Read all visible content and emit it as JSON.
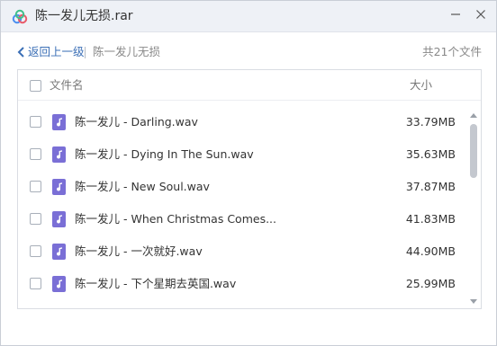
{
  "window": {
    "title": "陈一发儿无损.rar",
    "icon": "cloud-icon",
    "brand_color": "#4a8ef0"
  },
  "nav": {
    "back_label": "返回上一级",
    "breadcrumb": "陈一发儿无损",
    "file_count": "共21个文件",
    "link_color": "#3b6fb6"
  },
  "list": {
    "header_name": "文件名",
    "header_size": "大小",
    "file_icon": "audio-file-icon",
    "file_icon_color": "#7a6fd6",
    "rows": [
      {
        "name": "陈一发儿 - Darling.wav",
        "size": "33.79MB"
      },
      {
        "name": "陈一发儿 - Dying In The Sun.wav",
        "size": "35.63MB"
      },
      {
        "name": "陈一发儿 - New Soul.wav",
        "size": "37.87MB"
      },
      {
        "name": "陈一发儿 - When Christmas Comes...",
        "size": "41.83MB"
      },
      {
        "name": "陈一发儿 - 一次就好.wav",
        "size": "44.90MB"
      },
      {
        "name": "陈一发儿 - 下个星期去英国.wav",
        "size": "25.99MB"
      }
    ]
  }
}
